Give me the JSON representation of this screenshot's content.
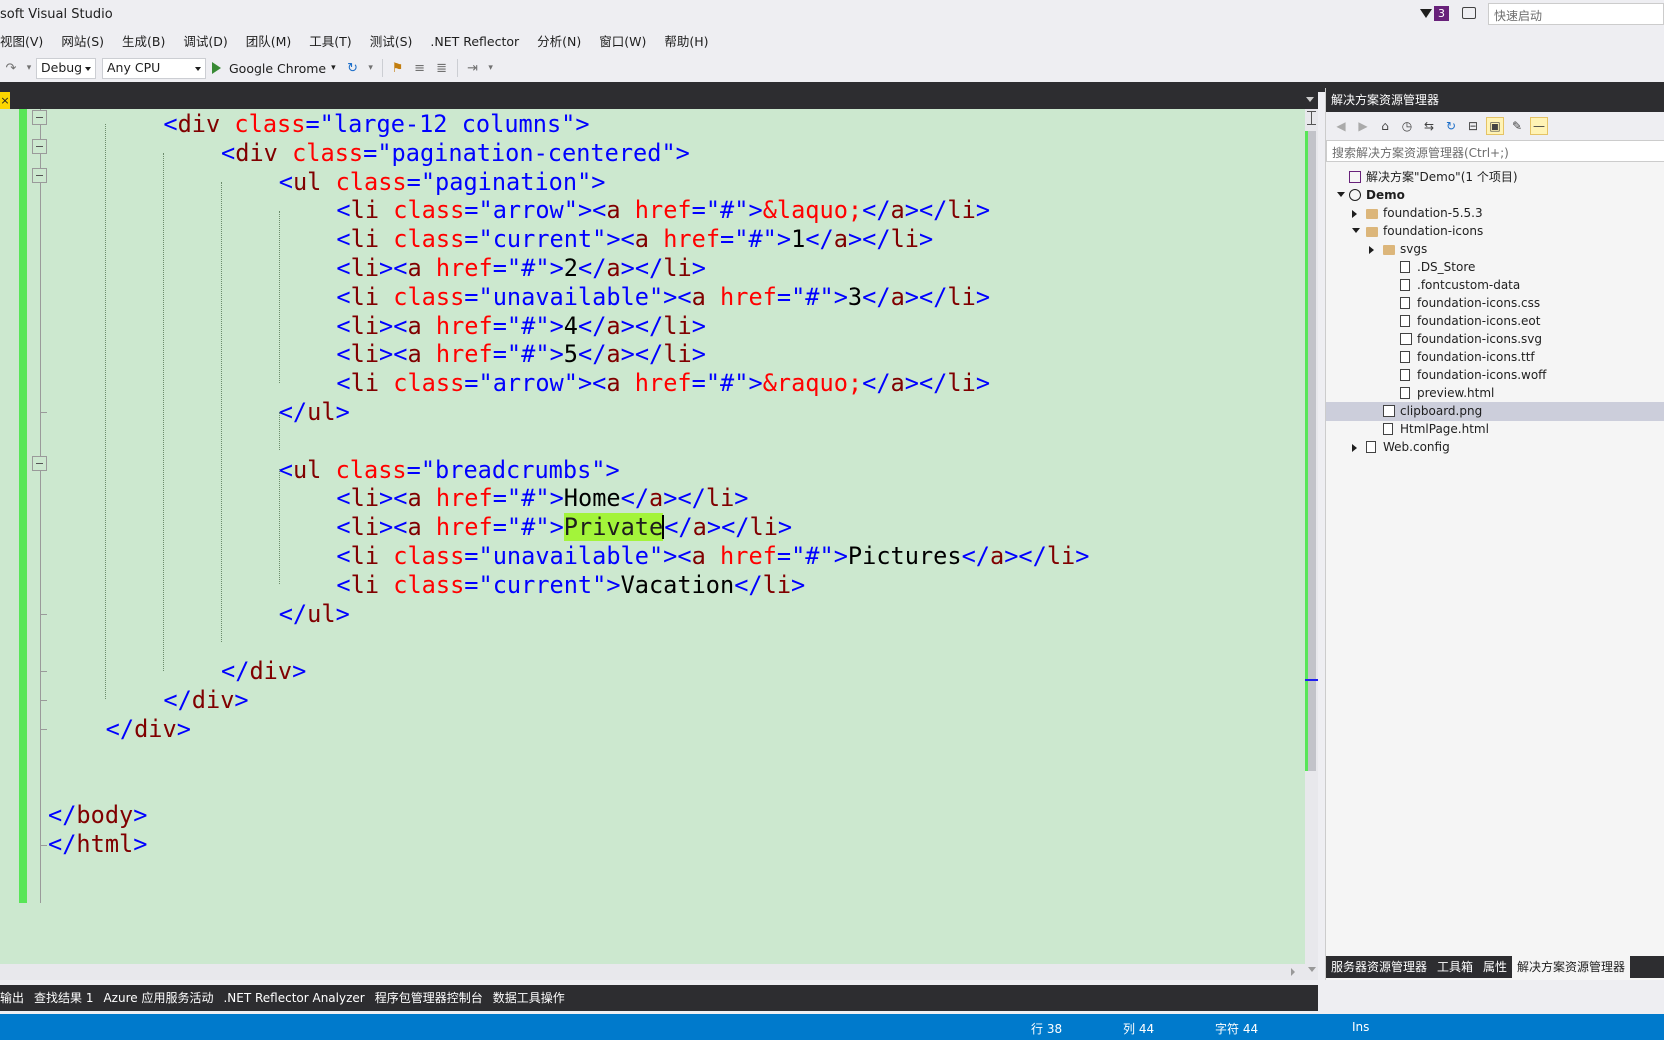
{
  "window": {
    "title": "soft Visual Studio",
    "notification_count": "3",
    "quick_launch_placeholder": "快速启动"
  },
  "menu": [
    "视图(V)",
    "网站(S)",
    "生成(B)",
    "调试(D)",
    "团队(M)",
    "工具(T)",
    "测试(S)",
    ".NET Reflector",
    "分析(N)",
    "窗口(W)",
    "帮助(H)"
  ],
  "toolbar": {
    "config": "Debug",
    "platform": "Any CPU",
    "run_target": "Google Chrome"
  },
  "editor": {
    "close_label": "×",
    "lines": [
      [
        [
          "br",
          "<"
        ],
        [
          "tg",
          "div"
        ],
        [
          "tx",
          " "
        ],
        [
          "at",
          "class"
        ],
        [
          "br",
          "=\""
        ],
        [
          "vl",
          "large-12 columns"
        ],
        [
          "br",
          "\">"
        ]
      ],
      [
        [
          "br",
          "<"
        ],
        [
          "tg",
          "div"
        ],
        [
          "tx",
          " "
        ],
        [
          "at",
          "class"
        ],
        [
          "br",
          "=\""
        ],
        [
          "vl",
          "pagination-centered"
        ],
        [
          "br",
          "\">"
        ]
      ],
      [
        [
          "br",
          "<"
        ],
        [
          "tg",
          "ul"
        ],
        [
          "tx",
          " "
        ],
        [
          "at",
          "class"
        ],
        [
          "br",
          "=\""
        ],
        [
          "vl",
          "pagination"
        ],
        [
          "br",
          "\">"
        ]
      ],
      [
        [
          "br",
          "<"
        ],
        [
          "tg",
          "li"
        ],
        [
          "tx",
          " "
        ],
        [
          "at",
          "class"
        ],
        [
          "br",
          "=\""
        ],
        [
          "vl",
          "arrow"
        ],
        [
          "br",
          "\"><"
        ],
        [
          "tg",
          "a"
        ],
        [
          "tx",
          " "
        ],
        [
          "at",
          "href"
        ],
        [
          "br",
          "=\""
        ],
        [
          "vl",
          "#"
        ],
        [
          "br",
          "\">"
        ],
        [
          "at",
          "&laquo;"
        ],
        [
          "br",
          "</"
        ],
        [
          "tg",
          "a"
        ],
        [
          "br",
          "></"
        ],
        [
          "tg",
          "li"
        ],
        [
          "br",
          ">"
        ]
      ],
      [
        [
          "br",
          "<"
        ],
        [
          "tg",
          "li"
        ],
        [
          "tx",
          " "
        ],
        [
          "at",
          "class"
        ],
        [
          "br",
          "=\""
        ],
        [
          "vl",
          "current"
        ],
        [
          "br",
          "\"><"
        ],
        [
          "tg",
          "a"
        ],
        [
          "tx",
          " "
        ],
        [
          "at",
          "href"
        ],
        [
          "br",
          "=\""
        ],
        [
          "vl",
          "#"
        ],
        [
          "br",
          "\">"
        ],
        [
          "tx",
          "1"
        ],
        [
          "br",
          "</"
        ],
        [
          "tg",
          "a"
        ],
        [
          "br",
          "></"
        ],
        [
          "tg",
          "li"
        ],
        [
          "br",
          ">"
        ]
      ],
      [
        [
          "br",
          "<"
        ],
        [
          "tg",
          "li"
        ],
        [
          "br",
          "><"
        ],
        [
          "tg",
          "a"
        ],
        [
          "tx",
          " "
        ],
        [
          "at",
          "href"
        ],
        [
          "br",
          "=\""
        ],
        [
          "vl",
          "#"
        ],
        [
          "br",
          "\">"
        ],
        [
          "tx",
          "2"
        ],
        [
          "br",
          "</"
        ],
        [
          "tg",
          "a"
        ],
        [
          "br",
          "></"
        ],
        [
          "tg",
          "li"
        ],
        [
          "br",
          ">"
        ]
      ],
      [
        [
          "br",
          "<"
        ],
        [
          "tg",
          "li"
        ],
        [
          "tx",
          " "
        ],
        [
          "at",
          "class"
        ],
        [
          "br",
          "=\""
        ],
        [
          "vl",
          "unavailable"
        ],
        [
          "br",
          "\"><"
        ],
        [
          "tg",
          "a"
        ],
        [
          "tx",
          " "
        ],
        [
          "at",
          "href"
        ],
        [
          "br",
          "=\""
        ],
        [
          "vl",
          "#"
        ],
        [
          "br",
          "\">"
        ],
        [
          "tx",
          "3"
        ],
        [
          "br",
          "</"
        ],
        [
          "tg",
          "a"
        ],
        [
          "br",
          "></"
        ],
        [
          "tg",
          "li"
        ],
        [
          "br",
          ">"
        ]
      ],
      [
        [
          "br",
          "<"
        ],
        [
          "tg",
          "li"
        ],
        [
          "br",
          "><"
        ],
        [
          "tg",
          "a"
        ],
        [
          "tx",
          " "
        ],
        [
          "at",
          "href"
        ],
        [
          "br",
          "=\""
        ],
        [
          "vl",
          "#"
        ],
        [
          "br",
          "\">"
        ],
        [
          "tx",
          "4"
        ],
        [
          "br",
          "</"
        ],
        [
          "tg",
          "a"
        ],
        [
          "br",
          "></"
        ],
        [
          "tg",
          "li"
        ],
        [
          "br",
          ">"
        ]
      ],
      [
        [
          "br",
          "<"
        ],
        [
          "tg",
          "li"
        ],
        [
          "br",
          "><"
        ],
        [
          "tg",
          "a"
        ],
        [
          "tx",
          " "
        ],
        [
          "at",
          "href"
        ],
        [
          "br",
          "=\""
        ],
        [
          "vl",
          "#"
        ],
        [
          "br",
          "\">"
        ],
        [
          "tx",
          "5"
        ],
        [
          "br",
          "</"
        ],
        [
          "tg",
          "a"
        ],
        [
          "br",
          "></"
        ],
        [
          "tg",
          "li"
        ],
        [
          "br",
          ">"
        ]
      ],
      [
        [
          "br",
          "<"
        ],
        [
          "tg",
          "li"
        ],
        [
          "tx",
          " "
        ],
        [
          "at",
          "class"
        ],
        [
          "br",
          "=\""
        ],
        [
          "vl",
          "arrow"
        ],
        [
          "br",
          "\"><"
        ],
        [
          "tg",
          "a"
        ],
        [
          "tx",
          " "
        ],
        [
          "at",
          "href"
        ],
        [
          "br",
          "=\""
        ],
        [
          "vl",
          "#"
        ],
        [
          "br",
          "\">"
        ],
        [
          "at",
          "&raquo;"
        ],
        [
          "br",
          "</"
        ],
        [
          "tg",
          "a"
        ],
        [
          "br",
          "></"
        ],
        [
          "tg",
          "li"
        ],
        [
          "br",
          ">"
        ]
      ],
      [
        [
          "br",
          "</"
        ],
        [
          "tg",
          "ul"
        ],
        [
          "br",
          ">"
        ]
      ],
      [],
      [
        [
          "br",
          "<"
        ],
        [
          "tg",
          "ul"
        ],
        [
          "tx",
          " "
        ],
        [
          "at",
          "class"
        ],
        [
          "br",
          "=\""
        ],
        [
          "vl",
          "breadcrumbs"
        ],
        [
          "br",
          "\">"
        ]
      ],
      [
        [
          "br",
          "<"
        ],
        [
          "tg",
          "li"
        ],
        [
          "br",
          "><"
        ],
        [
          "tg",
          "a"
        ],
        [
          "tx",
          " "
        ],
        [
          "at",
          "href"
        ],
        [
          "br",
          "=\""
        ],
        [
          "vl",
          "#"
        ],
        [
          "br",
          "\">"
        ],
        [
          "tx",
          "Home"
        ],
        [
          "br",
          "</"
        ],
        [
          "tg",
          "a"
        ],
        [
          "br",
          "></"
        ],
        [
          "tg",
          "li"
        ],
        [
          "br",
          ">"
        ]
      ],
      [
        [
          "br",
          "<"
        ],
        [
          "tg",
          "li"
        ],
        [
          "br",
          "><"
        ],
        [
          "tg",
          "a"
        ],
        [
          "tx",
          " "
        ],
        [
          "at",
          "href"
        ],
        [
          "br",
          "=\""
        ],
        [
          "vl",
          "#"
        ],
        [
          "br",
          "\">"
        ],
        [
          "hl",
          "Private"
        ],
        [
          "caret",
          ""
        ],
        [
          "br",
          "</"
        ],
        [
          "tg",
          "a"
        ],
        [
          "br",
          "></"
        ],
        [
          "tg",
          "li"
        ],
        [
          "br",
          ">"
        ]
      ],
      [
        [
          "br",
          "<"
        ],
        [
          "tg",
          "li"
        ],
        [
          "tx",
          " "
        ],
        [
          "at",
          "class"
        ],
        [
          "br",
          "=\""
        ],
        [
          "vl",
          "unavailable"
        ],
        [
          "br",
          "\"><"
        ],
        [
          "tg",
          "a"
        ],
        [
          "tx",
          " "
        ],
        [
          "at",
          "href"
        ],
        [
          "br",
          "=\""
        ],
        [
          "vl",
          "#"
        ],
        [
          "br",
          "\">"
        ],
        [
          "tx",
          "Pictures"
        ],
        [
          "br",
          "</"
        ],
        [
          "tg",
          "a"
        ],
        [
          "br",
          "></"
        ],
        [
          "tg",
          "li"
        ],
        [
          "br",
          ">"
        ]
      ],
      [
        [
          "br",
          "<"
        ],
        [
          "tg",
          "li"
        ],
        [
          "tx",
          " "
        ],
        [
          "at",
          "class"
        ],
        [
          "br",
          "=\""
        ],
        [
          "vl",
          "current"
        ],
        [
          "br",
          "\">"
        ],
        [
          "tx",
          "Vacation"
        ],
        [
          "br",
          "</"
        ],
        [
          "tg",
          "li"
        ],
        [
          "br",
          ">"
        ]
      ],
      [
        [
          "br",
          "</"
        ],
        [
          "tg",
          "ul"
        ],
        [
          "br",
          ">"
        ]
      ],
      [],
      [
        [
          "br",
          "</"
        ],
        [
          "tg",
          "div"
        ],
        [
          "br",
          ">"
        ]
      ],
      [
        [
          "br",
          "</"
        ],
        [
          "tg",
          "div"
        ],
        [
          "br",
          ">"
        ]
      ],
      [
        [
          "br",
          "</"
        ],
        [
          "tg",
          "div"
        ],
        [
          "br",
          ">"
        ]
      ],
      [],
      [],
      [
        [
          "br",
          "</"
        ],
        [
          "tg",
          "body"
        ],
        [
          "br",
          ">"
        ]
      ],
      [
        [
          "br",
          "</"
        ],
        [
          "tg",
          "html"
        ],
        [
          "br",
          ">"
        ]
      ]
    ]
  },
  "solution_explorer": {
    "title": "解决方案资源管理器",
    "search_placeholder": "搜索解决方案资源管理器(Ctrl+;)",
    "tree": [
      {
        "label": "解决方案\"Demo\"(1 个项目)",
        "icon": "solution-icon",
        "expand": "none"
      },
      {
        "label": "Demo",
        "icon": "globe-icon",
        "expand": "down",
        "bold": true
      },
      {
        "label": "foundation-5.5.3",
        "icon": "folder-icon",
        "expand": "right"
      },
      {
        "label": "foundation-icons",
        "icon": "folder-icon",
        "expand": "down"
      },
      {
        "label": "svgs",
        "icon": "folder-icon",
        "expand": "right"
      },
      {
        "label": ".DS_Store",
        "icon": "file-icon",
        "expand": "none"
      },
      {
        "label": ".fontcustom-data",
        "icon": "file-icon",
        "expand": "none"
      },
      {
        "label": "foundation-icons.css",
        "icon": "css-file-icon",
        "expand": "none"
      },
      {
        "label": "foundation-icons.eot",
        "icon": "file-icon",
        "expand": "none"
      },
      {
        "label": "foundation-icons.svg",
        "icon": "image-file-icon",
        "expand": "none"
      },
      {
        "label": "foundation-icons.ttf",
        "icon": "font-file-icon",
        "expand": "none"
      },
      {
        "label": "foundation-icons.woff",
        "icon": "file-icon",
        "expand": "none"
      },
      {
        "label": "preview.html",
        "icon": "html-file-icon",
        "expand": "none"
      },
      {
        "label": "clipboard.png",
        "icon": "image-file-icon",
        "expand": "none",
        "selected": true
      },
      {
        "label": "HtmlPage.html",
        "icon": "html-file-icon",
        "expand": "none"
      },
      {
        "label": "Web.config",
        "icon": "config-file-icon",
        "expand": "right"
      }
    ],
    "tabs": [
      "服务器资源管理器",
      "工具箱",
      "属性",
      "解决方案资源管理器"
    ]
  },
  "bottom_tabs": [
    "输出",
    "查找结果 1",
    "Azure 应用服务活动",
    ".NET Reflector Analyzer",
    "程序包管理器控制台",
    "数据工具操作"
  ],
  "status": {
    "line": "行 38",
    "col": "列 44",
    "char": "字符 44",
    "mode": "Ins"
  }
}
